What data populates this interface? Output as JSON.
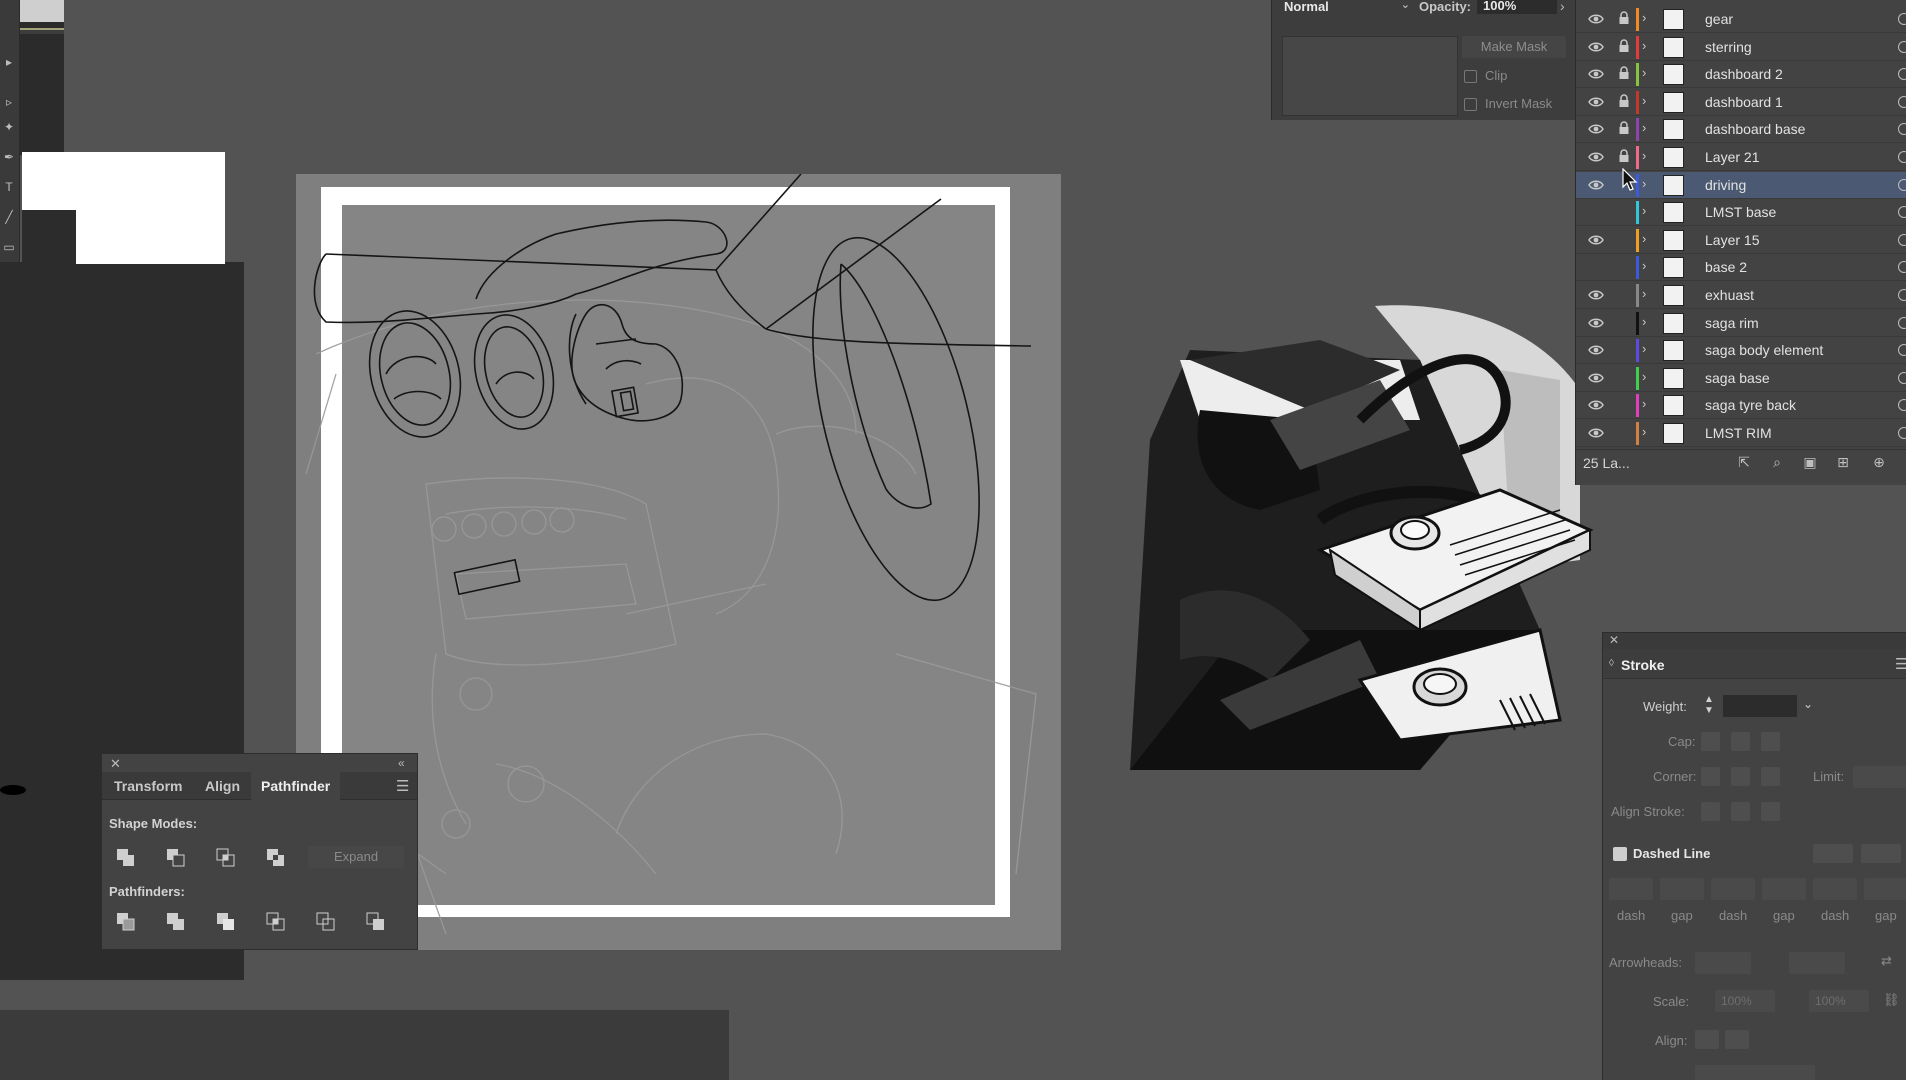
{
  "transparency": {
    "blend_mode": "Normal",
    "opacity_label": "Opacity:",
    "opacity_value": "100%",
    "make_mask": "Make Mask",
    "clip": "Clip",
    "invert_mask": "Invert Mask"
  },
  "layers": {
    "items": [
      {
        "name": "gear",
        "color": "#f08a24",
        "locked": true,
        "visible": true
      },
      {
        "name": "sterring",
        "color": "#e23b3b",
        "locked": true,
        "visible": true
      },
      {
        "name": "dashboard 2",
        "color": "#86c440",
        "locked": true,
        "visible": true
      },
      {
        "name": "dashboard 1",
        "color": "#c0392b",
        "locked": true,
        "visible": true
      },
      {
        "name": "dashboard base",
        "color": "#8e44ad",
        "locked": true,
        "visible": true
      },
      {
        "name": "Layer 21",
        "color": "#f06a8a",
        "locked": true,
        "visible": true
      },
      {
        "name": "driving",
        "color": "#3b5bdb",
        "locked": false,
        "visible": true,
        "selected": true
      },
      {
        "name": "LMST base",
        "color": "#30c8d8",
        "locked": false,
        "visible": false
      },
      {
        "name": "Layer 15",
        "color": "#f0a020",
        "locked": false,
        "visible": true
      },
      {
        "name": "base 2",
        "color": "#3b5bdb",
        "locked": false,
        "visible": false
      },
      {
        "name": "exhuast",
        "color": "#888888",
        "locked": false,
        "visible": true
      },
      {
        "name": "saga rim",
        "color": "#111111",
        "locked": false,
        "visible": true
      },
      {
        "name": "saga body element",
        "color": "#5b4be0",
        "locked": false,
        "visible": true
      },
      {
        "name": "saga base",
        "color": "#40d050",
        "locked": false,
        "visible": true
      },
      {
        "name": "saga tyre back",
        "color": "#e040c0",
        "locked": false,
        "visible": true
      },
      {
        "name": "LMST RIM",
        "color": "#d08040",
        "locked": false,
        "visible": true
      }
    ],
    "count_label": "25 La..."
  },
  "pathfinder": {
    "tabs": [
      "Transform",
      "Align",
      "Pathfinder"
    ],
    "active_tab": "Pathfinder",
    "shape_modes_label": "Shape Modes:",
    "pathfinders_label": "Pathfinders:",
    "expand": "Expand"
  },
  "stroke": {
    "title": "Stroke",
    "weight_label": "Weight:",
    "cap_label": "Cap:",
    "corner_label": "Corner:",
    "limit_label": "Limit:",
    "align_stroke_label": "Align Stroke:",
    "dashed_line_label": "Dashed Line",
    "dash_labels": [
      "dash",
      "gap",
      "dash",
      "gap",
      "dash",
      "gap"
    ],
    "arrowheads_label": "Arrowheads:",
    "scale_label": "Scale:",
    "scale_values": [
      "100%",
      "100%"
    ],
    "align_label": "Align:"
  }
}
